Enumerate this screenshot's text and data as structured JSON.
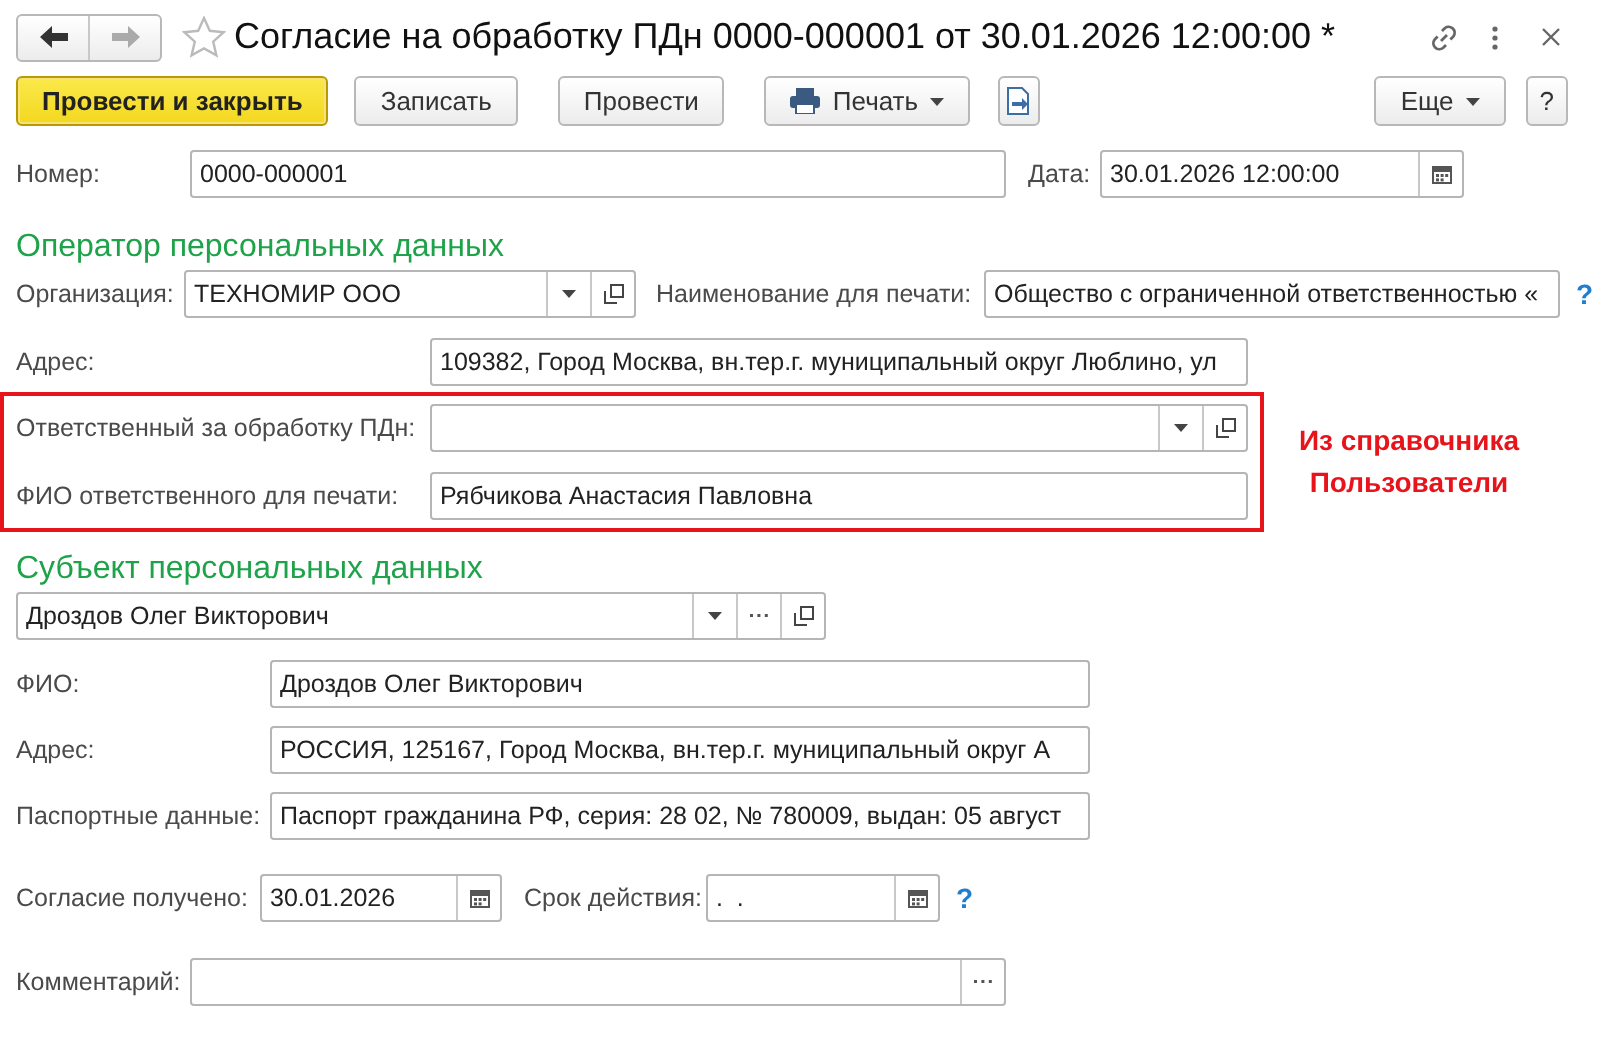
{
  "window": {
    "title": "Согласие на обработку ПДн 0000-000001 от 30.01.2026 12:00:00 *"
  },
  "toolbar": {
    "left": [
      {
        "kind": "default",
        "label": "Провести и закрыть"
      },
      {
        "kind": "plain",
        "label": "Записать"
      },
      {
        "kind": "plain",
        "label": "Провести"
      },
      {
        "kind": "print",
        "label": "Печать"
      },
      {
        "kind": "export"
      }
    ],
    "right": [
      {
        "kind": "menu",
        "label": "Еще"
      },
      {
        "kind": "plain",
        "label": "?"
      }
    ]
  },
  "header": {
    "number": {
      "label": "Номер:",
      "value": "0000-000001"
    },
    "date": {
      "label": "Дата:",
      "value": "30.01.2026 12:00:00"
    }
  },
  "operator": {
    "title": "Оператор персональных данных",
    "organization": {
      "label": "Организация:",
      "value": "ТЕХНОМИР ООО"
    },
    "print_name": {
      "label": "Наименование для печати:",
      "value": "Общество с ограниченной ответственностью «",
      "help": "?"
    },
    "address": {
      "label": "Адрес:",
      "value": "109382, Город Москва, вн.тер.г. муниципальный округ Люблино, ул"
    },
    "responsible": {
      "label": "Ответственный за обработку ПДн:"
    },
    "responsible_print_name": {
      "label": "ФИО ответственного для печати:",
      "value": "Рябчикова Анастасия Павловна"
    },
    "highlight_note": "Из справочника Пользователи"
  },
  "subject": {
    "title": "Субъект персональных данных",
    "person": {
      "value": "Дроздов Олег Викторович"
    },
    "full_name": {
      "label": "ФИО:",
      "value": "Дроздов Олег Викторович"
    },
    "address": {
      "label": "Адрес:",
      "value": "РОССИЯ, 125167, Город Москва, вн.тер.г. муниципальный округ А"
    },
    "passport": {
      "label": "Паспортные данные:",
      "value": "Паспорт гражданина РФ, серия: 28 02, № 780009, выдан: 05 август"
    }
  },
  "consent": {
    "received": {
      "label": "Согласие получено:",
      "value": "30.01.2026"
    },
    "valid_until": {
      "label": "Срок действия:",
      "value": ".  .",
      "help": "?"
    }
  },
  "comment": {
    "label": "Комментарий:"
  }
}
